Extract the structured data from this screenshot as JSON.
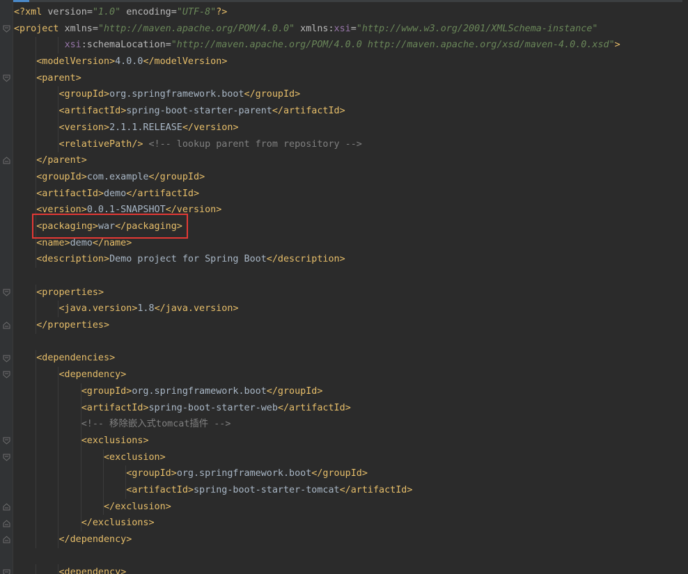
{
  "editor": {
    "language": "xml",
    "active_tab_accent": "#4a88c7",
    "highlight_color": "#e53935",
    "lines": [
      {
        "text": "<?xml version=\"1.0\" encoding=\"UTF-8\"?>"
      },
      {
        "text": "<project xmlns=\"http://maven.apache.org/POM/4.0.0\" xmlns:xsi=\"http://www.w3.org/2001/XMLSchema-instance\""
      },
      {
        "text": "         xsi:schemaLocation=\"http://maven.apache.org/POM/4.0.0 http://maven.apache.org/xsd/maven-4.0.0.xsd\">"
      },
      {
        "text": "    <modelVersion>4.0.0</modelVersion>"
      },
      {
        "text": "    <parent>"
      },
      {
        "text": "        <groupId>org.springframework.boot</groupId>"
      },
      {
        "text": "        <artifactId>spring-boot-starter-parent</artifactId>"
      },
      {
        "text": "        <version>2.1.1.RELEASE</version>"
      },
      {
        "text": "        <relativePath/> <!-- lookup parent from repository -->"
      },
      {
        "text": "    </parent>"
      },
      {
        "text": "    <groupId>com.example</groupId>"
      },
      {
        "text": "    <artifactId>demo</artifactId>"
      },
      {
        "text": "    <version>0.0.1-SNAPSHOT</version>"
      },
      {
        "text": "    <packaging>war</packaging>"
      },
      {
        "text": "    <name>demo</name>"
      },
      {
        "text": "    <description>Demo project for Spring Boot</description>"
      },
      {
        "text": ""
      },
      {
        "text": "    <properties>"
      },
      {
        "text": "        <java.version>1.8</java.version>"
      },
      {
        "text": "    </properties>"
      },
      {
        "text": ""
      },
      {
        "text": "    <dependencies>"
      },
      {
        "text": "        <dependency>"
      },
      {
        "text": "            <groupId>org.springframework.boot</groupId>"
      },
      {
        "text": "            <artifactId>spring-boot-starter-web</artifactId>"
      },
      {
        "text": "            <!-- 移除嵌入式tomcat插件 -->"
      },
      {
        "text": "            <exclusions>"
      },
      {
        "text": "                <exclusion>"
      },
      {
        "text": "                    <groupId>org.springframework.boot</groupId>"
      },
      {
        "text": "                    <artifactId>spring-boot-starter-tomcat</artifactId>"
      },
      {
        "text": "                </exclusion>"
      },
      {
        "text": "            </exclusions>"
      },
      {
        "text": "        </dependency>"
      },
      {
        "text": ""
      },
      {
        "text": "        <dependency>"
      }
    ],
    "highlighted_line": 13
  }
}
